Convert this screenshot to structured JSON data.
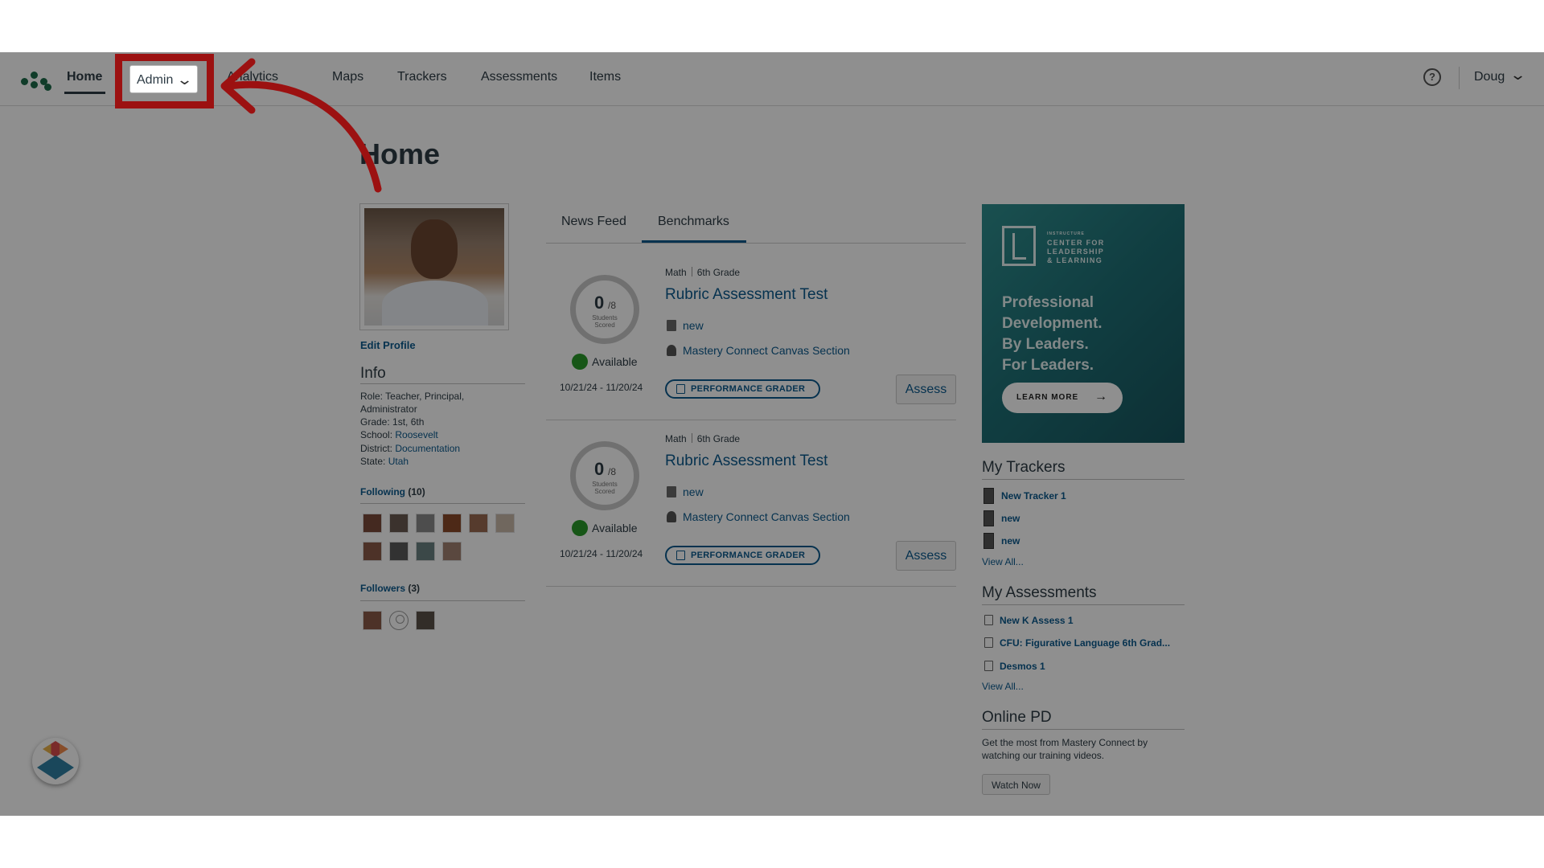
{
  "nav": {
    "home": "Home",
    "admin": "Admin",
    "analytics": "Analytics",
    "maps": "Maps",
    "trackers": "Trackers",
    "assessments": "Assessments",
    "items": "Items",
    "user": "Doug",
    "help_glyph": "?"
  },
  "page": {
    "title": "Home"
  },
  "profile": {
    "edit": "Edit Profile",
    "info_heading": "Info",
    "role_label": "Role:",
    "role_value": "Teacher, Principal,",
    "role_value2": "Administrator",
    "grade_label": "Grade:",
    "grade_value": "1st, 6th",
    "school_label": "School:",
    "school_value": "Roosevelt",
    "district_label": "District:",
    "district_value": "Documentation",
    "state_label": "State:",
    "state_value": "Utah",
    "following_label": "Following",
    "following_count": "(10)",
    "followers_label": "Followers",
    "followers_count": "(3)"
  },
  "tabs": {
    "news": "News Feed",
    "benchmarks": "Benchmarks"
  },
  "cards": [
    {
      "score": "0",
      "total": "/8",
      "caption1": "Students",
      "caption2": "Scored",
      "status": "Available",
      "dates": "10/21/24 - 11/20/24",
      "subject": "Math",
      "grade": "6th Grade",
      "title": "Rubric Assessment Test",
      "tracker": "new",
      "section": "Mastery Connect Canvas Section",
      "grader": "PERFORMANCE GRADER",
      "assess": "Assess"
    },
    {
      "score": "0",
      "total": "/8",
      "caption1": "Students",
      "caption2": "Scored",
      "status": "Available",
      "dates": "10/21/24 - 11/20/24",
      "subject": "Math",
      "grade": "6th Grade",
      "title": "Rubric Assessment Test",
      "tracker": "new",
      "section": "Mastery Connect Canvas Section",
      "grader": "PERFORMANCE GRADER",
      "assess": "Assess"
    }
  ],
  "ad": {
    "org_small": "INSTRUCTURE",
    "org_line1": "CENTER FOR",
    "org_line2": "LEADERSHIP",
    "org_line3": "& LEARNING",
    "headline1": "Professional",
    "headline2": "Development.",
    "headline3": "By Leaders.",
    "headline4": "For Leaders.",
    "cta": "LEARN MORE"
  },
  "trackers": {
    "heading": "My Trackers",
    "items": [
      "New Tracker 1",
      "new",
      "new"
    ],
    "view_all": "View All..."
  },
  "my_assessments": {
    "heading": "My Assessments",
    "items": [
      "New K Assess 1",
      "CFU: Figurative Language 6th Grad...",
      "Desmos 1"
    ],
    "view_all": "View All..."
  },
  "online_pd": {
    "heading": "Online PD",
    "text": "Get the most from Mastery Connect by watching our training videos.",
    "button": "Watch Now"
  },
  "colors": {
    "highlight": "#9c1111",
    "link": "#0b5a8e",
    "available": "#2a9a2a"
  }
}
